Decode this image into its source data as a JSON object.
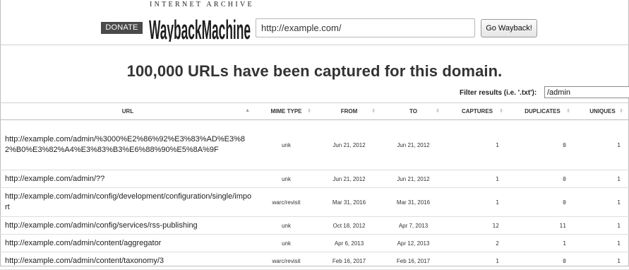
{
  "header": {
    "donate_label": "DONATE",
    "logo_top": "INTERNET ARCHIVE",
    "logo_word": "WaybackMachine",
    "url_value": "http://example.com/",
    "go_label": "Go Wayback!"
  },
  "title": "100,000 URLs have been captured for this domain.",
  "filter": {
    "label": "Filter results (i.e. '.txt'):",
    "value": "/admin"
  },
  "table": {
    "columns": [
      "URL",
      "MIME TYPE",
      "FROM",
      "TO",
      "CAPTURES",
      "DUPLICATES",
      "UNIQUES"
    ],
    "sorted_column": "URL",
    "rows": [
      {
        "url": "http://example.com/admin/%3000%E2%86%92%E3%83%AD%E3%82%B0%E3%82%A4%E3%83%B3%E6%88%90%E5%8A%9F",
        "mime": "unk",
        "from": "Jun 21, 2012",
        "to": "Jun 21, 2012",
        "captures": "1",
        "duplicates": "0",
        "uniques": "1"
      },
      {
        "url": "http://example.com/admin/??",
        "mime": "unk",
        "from": "Jun 21, 2012",
        "to": "Jun 21, 2012",
        "captures": "1",
        "duplicates": "0",
        "uniques": "1"
      },
      {
        "url": "http://example.com/admin/config/development/configuration/single/import",
        "mime": "warc/revisit",
        "from": "Mar 31, 2016",
        "to": "Mar 31, 2016",
        "captures": "1",
        "duplicates": "0",
        "uniques": "1"
      },
      {
        "url": "http://example.com/admin/config/services/rss-publishing",
        "mime": "unk",
        "from": "Oct 18, 2012",
        "to": "Apr 7, 2013",
        "captures": "12",
        "duplicates": "11",
        "uniques": "1"
      },
      {
        "url": "http://example.com/admin/content/aggregator",
        "mime": "unk",
        "from": "Apr 6, 2013",
        "to": "Apr 12, 2013",
        "captures": "2",
        "duplicates": "1",
        "uniques": "1"
      },
      {
        "url": "http://example.com/admin/content/taxonomy/3",
        "mime": "warc/revisit",
        "from": "Feb 16, 2017",
        "to": "Feb 16, 2017",
        "captures": "1",
        "duplicates": "0",
        "uniques": "1"
      }
    ]
  }
}
